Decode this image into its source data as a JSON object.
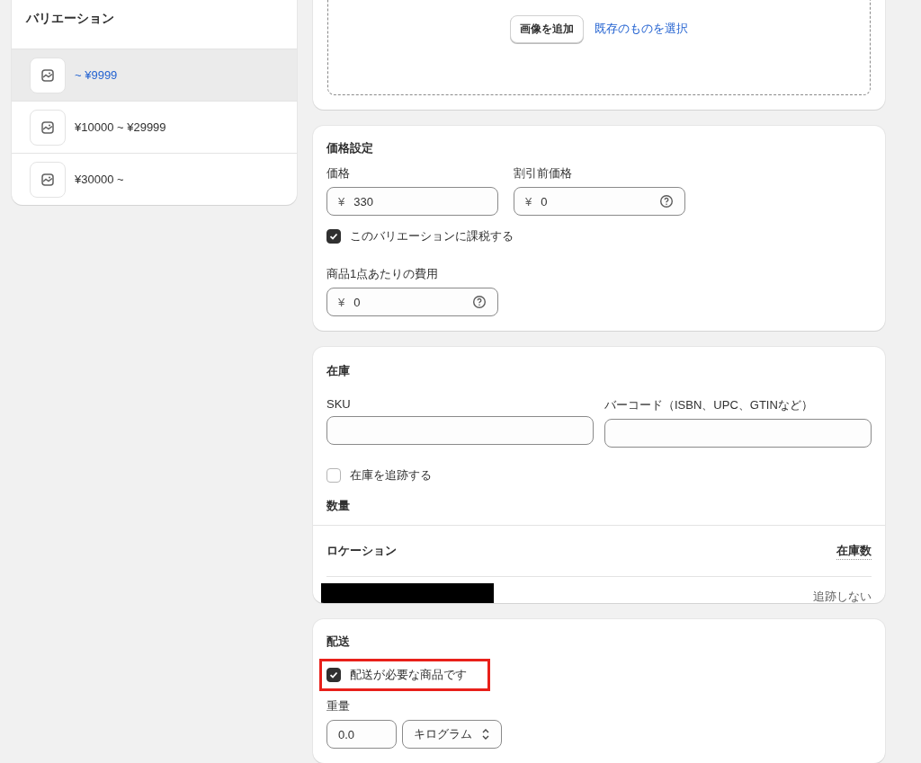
{
  "variants": {
    "title": "バリエーション",
    "items": [
      {
        "label": "~ ¥9999",
        "selected": true
      },
      {
        "label": "¥10000 ~ ¥29999",
        "selected": false
      },
      {
        "label": "¥30000 ~",
        "selected": false
      }
    ]
  },
  "media": {
    "add_button": "画像を追加",
    "select_link": "既存のものを選択"
  },
  "pricing": {
    "title": "価格設定",
    "price": {
      "label": "価格",
      "currency": "¥",
      "value": "330"
    },
    "compare_price": {
      "label": "割引前価格",
      "currency": "¥",
      "value": "0"
    },
    "charge_tax": {
      "label": "このバリエーションに課税する",
      "checked": true
    },
    "cost": {
      "label": "商品1点あたりの費用",
      "currency": "¥",
      "value": "0"
    }
  },
  "inventory": {
    "title": "在庫",
    "sku": {
      "label": "SKU"
    },
    "barcode": {
      "label": "バーコード（ISBN、UPC、GTINなど）"
    },
    "track": {
      "label": "在庫を追跡する",
      "checked": false
    },
    "quantity_title": "数量",
    "columns": [
      "ロケーション",
      "在庫数"
    ],
    "rows": [
      {
        "location_hidden": true,
        "value": "追跡しない"
      }
    ]
  },
  "shipping": {
    "title": "配送",
    "requires_shipping": {
      "label": "配送が必要な商品です",
      "checked": true,
      "highlighted": true
    },
    "weight": {
      "label": "重量",
      "value": "0.0",
      "unit": "キログラム"
    }
  }
}
